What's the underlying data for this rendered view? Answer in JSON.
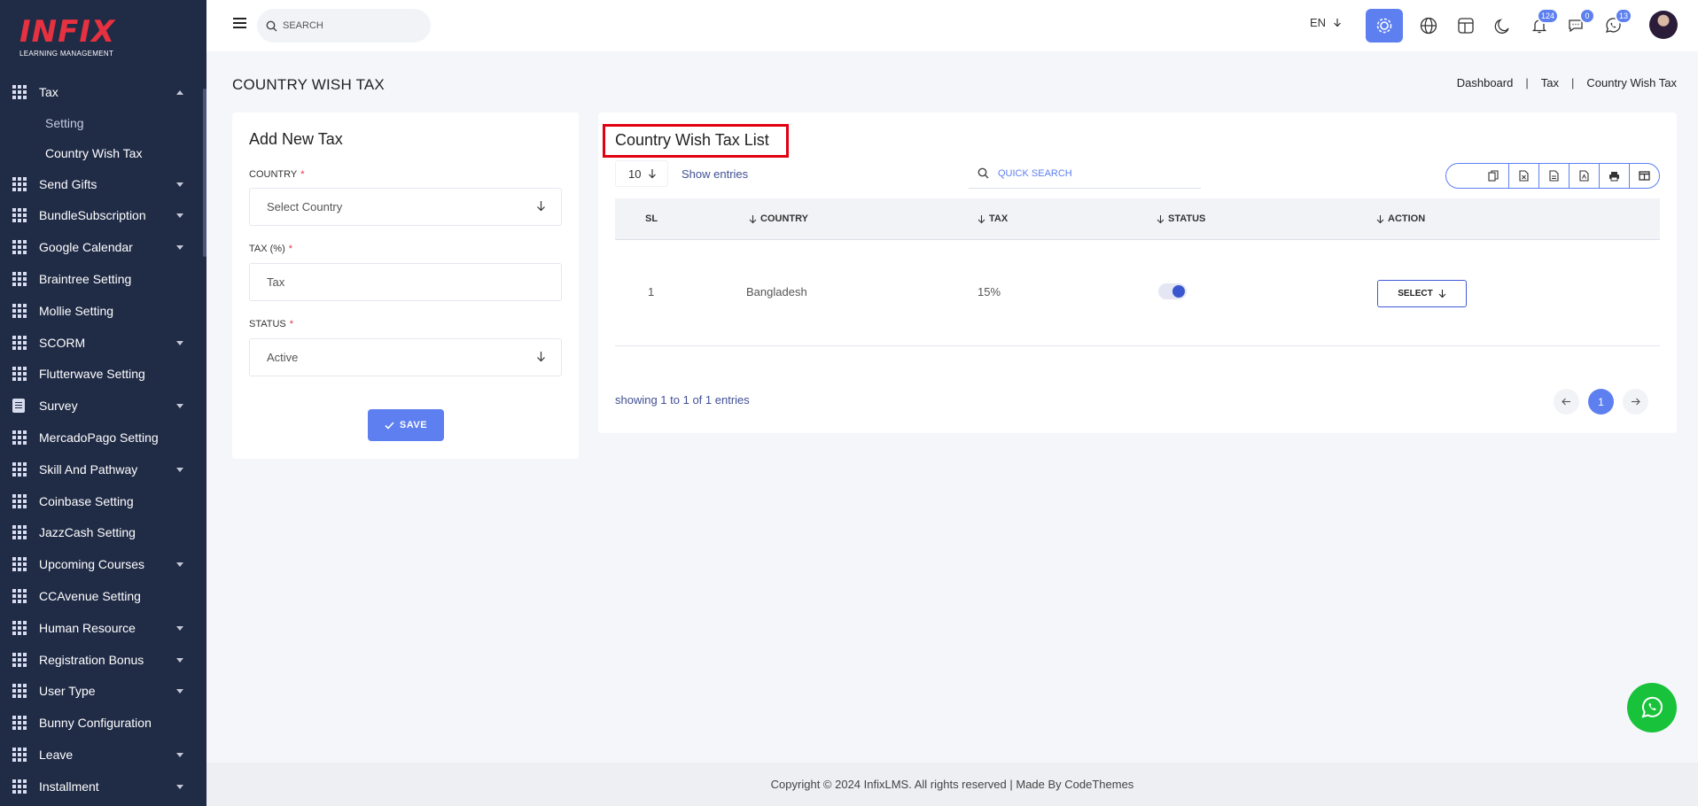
{
  "brand": {
    "name": "INFIX",
    "subtitle": "LEARNING MANAGEMENT"
  },
  "sidebar": {
    "items": [
      {
        "label": "Tax",
        "icon": "grid-icon",
        "expanded": true,
        "has_caret": true
      },
      {
        "label": "Send Gifts",
        "icon": "grid-icon",
        "has_caret": true
      },
      {
        "label": "BundleSubscription",
        "icon": "grid-icon",
        "has_caret": true
      },
      {
        "label": "Google Calendar",
        "icon": "grid-icon",
        "has_caret": true
      },
      {
        "label": "Braintree Setting",
        "icon": "grid-icon",
        "has_caret": false
      },
      {
        "label": "Mollie Setting",
        "icon": "grid-icon",
        "has_caret": false
      },
      {
        "label": "SCORM",
        "icon": "grid-icon",
        "has_caret": true
      },
      {
        "label": "Flutterwave Setting",
        "icon": "grid-icon",
        "has_caret": false
      },
      {
        "label": "Survey",
        "icon": "document-icon",
        "has_caret": true
      },
      {
        "label": "MercadoPago Setting",
        "icon": "grid-icon",
        "has_caret": false
      },
      {
        "label": "Skill And Pathway",
        "icon": "grid-icon",
        "has_caret": true
      },
      {
        "label": "Coinbase Setting",
        "icon": "grid-icon",
        "has_caret": false
      },
      {
        "label": "JazzCash Setting",
        "icon": "grid-icon",
        "has_caret": false
      },
      {
        "label": "Upcoming Courses",
        "icon": "grid-icon",
        "has_caret": true
      },
      {
        "label": "CCAvenue Setting",
        "icon": "grid-icon",
        "has_caret": false
      },
      {
        "label": "Human Resource",
        "icon": "grid-icon",
        "has_caret": true
      },
      {
        "label": "Registration Bonus",
        "icon": "grid-icon",
        "has_caret": true
      },
      {
        "label": "User Type",
        "icon": "grid-icon",
        "has_caret": true
      },
      {
        "label": "Bunny Configuration",
        "icon": "grid-icon",
        "has_caret": false
      },
      {
        "label": "Leave",
        "icon": "grid-icon",
        "has_caret": true
      },
      {
        "label": "Installment",
        "icon": "grid-icon",
        "has_caret": true
      }
    ],
    "tax_submenu": [
      {
        "label": "Setting",
        "active": false
      },
      {
        "label": "Country Wish Tax",
        "active": true
      }
    ]
  },
  "header": {
    "search_placeholder": "SEARCH",
    "language": "EN",
    "notifications_count": "124",
    "messages_count": "0",
    "whatsapp_count": "13"
  },
  "page": {
    "title": "COUNTRY WISH TAX",
    "breadcrumb": [
      "Dashboard",
      "Tax",
      "Country Wish Tax"
    ]
  },
  "add_form": {
    "title": "Add New Tax",
    "country_label": "COUNTRY",
    "country_value": "Select Country",
    "tax_label": "TAX (%)",
    "tax_placeholder": "Tax",
    "status_label": "STATUS",
    "status_value": "Active",
    "required_mark": "*",
    "save_label": "SAVE"
  },
  "list": {
    "title": "Country Wish Tax List",
    "entries_value": "10",
    "show_entries_label": "Show entries",
    "quick_search_placeholder": "QUICK SEARCH",
    "columns": [
      "SL",
      "COUNTRY",
      "TAX",
      "STATUS",
      "ACTION"
    ],
    "rows": [
      {
        "sl": "1",
        "country": "Bangladesh",
        "tax": "15%",
        "status_on": true,
        "action_label": "SELECT"
      }
    ],
    "showing_text": "showing 1 to 1 of 1 entries",
    "current_page": "1"
  },
  "footer": {
    "text": "Copyright © 2024 InfixLMS. All rights reserved | Made By CodeThemes"
  },
  "colors": {
    "accent": "#5d7ff0",
    "sidebar_bg": "#202b46",
    "highlight_box": "#e00010",
    "whatsapp": "#18c33b"
  }
}
